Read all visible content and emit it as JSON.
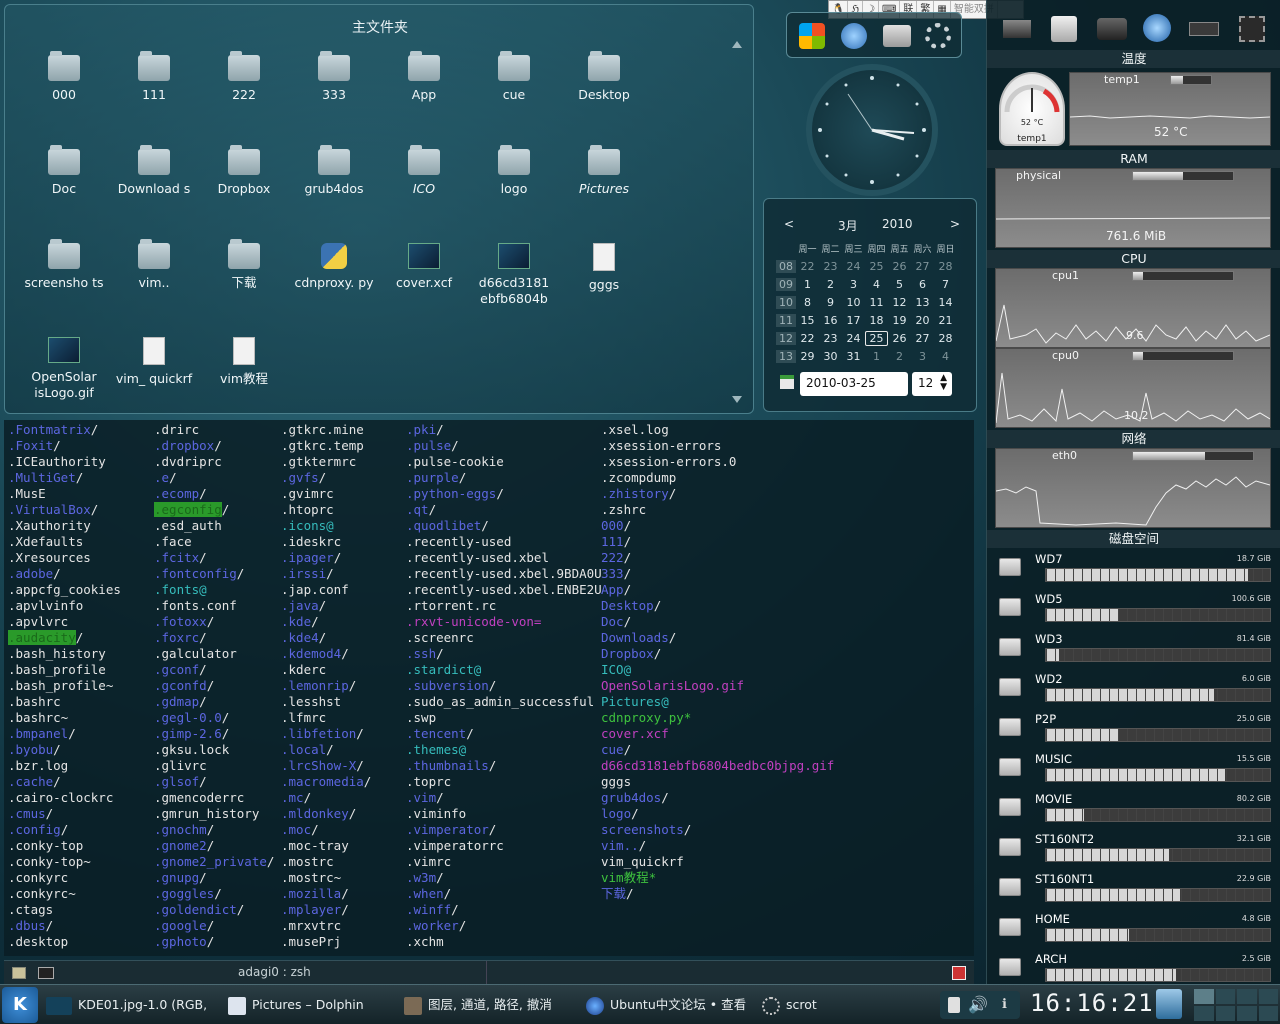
{
  "input_method": {
    "items": [
      "联",
      "繁",
      "智能双拼"
    ]
  },
  "folder_view": {
    "title": "主文件夹",
    "items": [
      {
        "label": "000",
        "kind": "folder"
      },
      {
        "label": "111",
        "kind": "folder"
      },
      {
        "label": "222",
        "kind": "folder"
      },
      {
        "label": "333",
        "kind": "folder"
      },
      {
        "label": "App",
        "kind": "folder"
      },
      {
        "label": "cue",
        "kind": "folder"
      },
      {
        "label": "Desktop",
        "kind": "folder"
      },
      {
        "label": "Doc",
        "kind": "folder"
      },
      {
        "label": "Download s",
        "kind": "folder"
      },
      {
        "label": "Dropbox",
        "kind": "folder"
      },
      {
        "label": "grub4dos",
        "kind": "folder"
      },
      {
        "label": "ICO",
        "kind": "folder-link"
      },
      {
        "label": "logo",
        "kind": "folder"
      },
      {
        "label": "Pictures",
        "kind": "folder-link"
      },
      {
        "label": "screensho ts",
        "kind": "folder"
      },
      {
        "label": "vim..",
        "kind": "folder"
      },
      {
        "label": "下载",
        "kind": "folder"
      },
      {
        "label": "cdnproxy. py",
        "kind": "python"
      },
      {
        "label": "cover.xcf",
        "kind": "image"
      },
      {
        "label": "d66cd3181 ebfb6804b",
        "kind": "image"
      },
      {
        "label": "gggs",
        "kind": "document"
      },
      {
        "label": "OpenSolar isLogo.gif",
        "kind": "image"
      },
      {
        "label": "vim_ quickrf",
        "kind": "document"
      },
      {
        "label": "vim教程",
        "kind": "document"
      }
    ]
  },
  "terminal": {
    "title": "adagi0 : zsh",
    "columns": [
      [
        [
          "c-dir",
          ".Fontmatrix"
        ],
        [
          "c-dir",
          ".Foxit"
        ],
        [
          "c-plain",
          ".ICEauthority"
        ],
        [
          "c-dir",
          ".MultiGet"
        ],
        [
          "c-plain",
          ".MusE"
        ],
        [
          "c-dir",
          ".VirtualBox"
        ],
        [
          "c-plain",
          ".Xauthority"
        ],
        [
          "c-plain",
          ".Xdefaults"
        ],
        [
          "c-plain",
          ".Xresources"
        ],
        [
          "c-dir",
          ".adobe"
        ],
        [
          "c-plain",
          ".appcfg_cookies"
        ],
        [
          "c-plain",
          ".apvlvinfo"
        ],
        [
          "c-plain",
          ".apvlvrc"
        ],
        [
          "c-hl",
          ".audacity"
        ],
        [
          "c-plain",
          ".bash_history"
        ],
        [
          "c-plain",
          ".bash_profile"
        ],
        [
          "c-plain",
          ".bash_profile~"
        ],
        [
          "c-plain",
          ".bashrc"
        ],
        [
          "c-plain",
          ".bashrc~"
        ],
        [
          "c-dir",
          ".bmpanel"
        ],
        [
          "c-dir",
          ".byobu"
        ],
        [
          "c-plain",
          ".bzr.log"
        ],
        [
          "c-dir",
          ".cache"
        ],
        [
          "c-plain",
          ".cairo-clockrc"
        ],
        [
          "c-dir",
          ".cmus"
        ],
        [
          "c-dir",
          ".config"
        ],
        [
          "c-plain",
          ".conky-top"
        ],
        [
          "c-plain",
          ".conky-top~"
        ],
        [
          "c-plain",
          ".conkyrc"
        ],
        [
          "c-plain",
          ".conkyrc~"
        ],
        [
          "c-plain",
          ".ctags"
        ],
        [
          "c-dir",
          ".dbus"
        ],
        [
          "c-plain",
          ".desktop"
        ]
      ],
      [
        [
          "c-plain",
          ".drirc"
        ],
        [
          "c-dir",
          ".dropbox"
        ],
        [
          "c-plain",
          ".dvdriprc"
        ],
        [
          "c-dir",
          ".e"
        ],
        [
          "c-dir",
          ".ecomp"
        ],
        [
          "c-hl",
          ".egconfig"
        ],
        [
          "c-plain",
          ".esd_auth"
        ],
        [
          "c-plain",
          ".face"
        ],
        [
          "c-dir",
          ".fcitx"
        ],
        [
          "c-dir",
          ".fontconfig"
        ],
        [
          "c-link",
          ".fonts@"
        ],
        [
          "c-plain",
          ".fonts.conf"
        ],
        [
          "c-dir",
          ".fotoxx"
        ],
        [
          "c-dir",
          ".foxrc"
        ],
        [
          "c-plain",
          ".galculator"
        ],
        [
          "c-dir",
          ".gconf"
        ],
        [
          "c-dir",
          ".gconfd"
        ],
        [
          "c-dir",
          ".gdmap"
        ],
        [
          "c-dir",
          ".gegl-0.0"
        ],
        [
          "c-dir",
          ".gimp-2.6"
        ],
        [
          "c-plain",
          ".gksu.lock"
        ],
        [
          "c-plain",
          ".glivrc"
        ],
        [
          "c-dir",
          ".glsof"
        ],
        [
          "c-plain",
          ".gmencoderrc"
        ],
        [
          "c-plain",
          ".gmrun_history"
        ],
        [
          "c-dir",
          ".gnochm"
        ],
        [
          "c-dir",
          ".gnome2"
        ],
        [
          "c-dir",
          ".gnome2_private"
        ],
        [
          "c-dir",
          ".gnupg"
        ],
        [
          "c-dir",
          ".goggles"
        ],
        [
          "c-dir",
          ".goldendict"
        ],
        [
          "c-dir",
          ".google"
        ],
        [
          "c-dir",
          ".gphoto"
        ]
      ],
      [
        [
          "c-plain",
          ".gtkrc.mine"
        ],
        [
          "c-plain",
          ".gtkrc.temp"
        ],
        [
          "c-plain",
          ".gtktermrc"
        ],
        [
          "c-dir",
          ".gvfs"
        ],
        [
          "c-plain",
          ".gvimrc"
        ],
        [
          "c-plain",
          ".htoprc"
        ],
        [
          "c-link",
          ".icons@"
        ],
        [
          "c-plain",
          ".ideskrc"
        ],
        [
          "c-dir",
          ".ipager"
        ],
        [
          "c-dir",
          ".irssi"
        ],
        [
          "c-plain",
          ".jap.conf"
        ],
        [
          "c-dir",
          ".java"
        ],
        [
          "c-dir",
          ".kde"
        ],
        [
          "c-dir",
          ".kde4"
        ],
        [
          "c-dir",
          ".kdemod4"
        ],
        [
          "c-plain",
          ".kderc"
        ],
        [
          "c-dir",
          ".lemonrip"
        ],
        [
          "c-plain",
          ".lesshst"
        ],
        [
          "c-plain",
          ".lfmrc"
        ],
        [
          "c-dir",
          ".libfetion"
        ],
        [
          "c-dir",
          ".local"
        ],
        [
          "c-dir",
          ".lrcShow-X"
        ],
        [
          "c-dir",
          ".macromedia"
        ],
        [
          "c-dir",
          ".mc"
        ],
        [
          "c-dir",
          ".mldonkey"
        ],
        [
          "c-dir",
          ".moc"
        ],
        [
          "c-plain",
          ".moc-tray"
        ],
        [
          "c-plain",
          ".mostrc"
        ],
        [
          "c-plain",
          ".mostrc~"
        ],
        [
          "c-dir",
          ".mozilla"
        ],
        [
          "c-dir",
          ".mplayer"
        ],
        [
          "c-plain",
          ".mrxvtrc"
        ],
        [
          "c-plain",
          ".musePrj"
        ]
      ],
      [
        [
          "c-dir",
          ".pki"
        ],
        [
          "c-dir",
          ".pulse"
        ],
        [
          "c-plain",
          ".pulse-cookie"
        ],
        [
          "c-dir",
          ".purple"
        ],
        [
          "c-dir",
          ".python-eggs"
        ],
        [
          "c-dir",
          ".qt"
        ],
        [
          "c-dir",
          ".quodlibet"
        ],
        [
          "c-plain",
          ".recently-used"
        ],
        [
          "c-plain",
          ".recently-used.xbel"
        ],
        [
          "c-plain",
          ".recently-used.xbel.9BDA0U"
        ],
        [
          "c-plain",
          ".recently-used.xbel.ENBE2U"
        ],
        [
          "c-plain",
          ".rtorrent.rc"
        ],
        [
          "c-img",
          ".rxvt-unicode-von="
        ],
        [
          "c-plain",
          ".screenrc"
        ],
        [
          "c-dir",
          ".ssh"
        ],
        [
          "c-link",
          ".stardict@"
        ],
        [
          "c-dir",
          ".subversion"
        ],
        [
          "c-plain",
          ".sudo_as_admin_successful"
        ],
        [
          "c-plain",
          ".swp"
        ],
        [
          "c-dir",
          ".tencent"
        ],
        [
          "c-link",
          ".themes@"
        ],
        [
          "c-dir",
          ".thumbnails"
        ],
        [
          "c-plain",
          ".toprc"
        ],
        [
          "c-dir",
          ".vim"
        ],
        [
          "c-plain",
          ".viminfo"
        ],
        [
          "c-dir",
          ".vimperator"
        ],
        [
          "c-plain",
          ".vimperatorrc"
        ],
        [
          "c-plain",
          ".vimrc"
        ],
        [
          "c-dir",
          ".w3m"
        ],
        [
          "c-dir",
          ".when"
        ],
        [
          "c-dir",
          ".winff"
        ],
        [
          "c-dir",
          ".worker"
        ],
        [
          "c-plain",
          ".xchm"
        ]
      ],
      [
        [
          "c-plain",
          ".xsel.log"
        ],
        [
          "c-plain",
          ".xsession-errors"
        ],
        [
          "c-plain",
          ".xsession-errors.0"
        ],
        [
          "c-plain",
          ".zcompdump"
        ],
        [
          "c-dir",
          ".zhistory"
        ],
        [
          "c-plain",
          ".zshrc"
        ],
        [
          "c-dir",
          "000"
        ],
        [
          "c-dir",
          "111"
        ],
        [
          "c-dir",
          "222"
        ],
        [
          "c-dir",
          "333"
        ],
        [
          "c-dir",
          "App"
        ],
        [
          "c-dir",
          "Desktop"
        ],
        [
          "c-dir",
          "Doc"
        ],
        [
          "c-dir",
          "Downloads"
        ],
        [
          "c-dir",
          "Dropbox"
        ],
        [
          "c-link",
          "ICO@"
        ],
        [
          "c-img",
          "OpenSolarisLogo.gif"
        ],
        [
          "c-link",
          "Pictures@"
        ],
        [
          "c-exe",
          "cdnproxy.py*"
        ],
        [
          "c-img",
          "cover.xcf"
        ],
        [
          "c-dir",
          "cue"
        ],
        [
          "c-img",
          "d66cd3181ebfb6804bedbc0bjpg.gif"
        ],
        [
          "c-plain",
          "gggs"
        ],
        [
          "c-dir",
          "grub4dos"
        ],
        [
          "c-dir",
          "logo"
        ],
        [
          "c-dir",
          "screenshots"
        ],
        [
          "c-dir",
          "vim.."
        ],
        [
          "c-plain",
          "vim_quickrf"
        ],
        [
          "c-exe",
          "vim教程*"
        ],
        [
          "c-dir",
          "下载"
        ]
      ]
    ]
  },
  "calendar": {
    "prev": "<",
    "next": ">",
    "month": "3月",
    "year": "2010",
    "day_headers": [
      "周一",
      "周二",
      "周三",
      "周四",
      "周五",
      "周六",
      "周日"
    ],
    "weeks": [
      {
        "wk": "08",
        "days": [
          "22",
          "23",
          "24",
          "25",
          "26",
          "27",
          "28"
        ],
        "dim": [
          1,
          1,
          1,
          1,
          1,
          1,
          1
        ]
      },
      {
        "wk": "09",
        "days": [
          "1",
          "2",
          "3",
          "4",
          "5",
          "6",
          "7"
        ],
        "dim": [
          0,
          0,
          0,
          0,
          0,
          0,
          0
        ]
      },
      {
        "wk": "10",
        "days": [
          "8",
          "9",
          "10",
          "11",
          "12",
          "13",
          "14"
        ],
        "dim": [
          0,
          0,
          0,
          0,
          0,
          0,
          0
        ]
      },
      {
        "wk": "11",
        "days": [
          "15",
          "16",
          "17",
          "18",
          "19",
          "20",
          "21"
        ],
        "dim": [
          0,
          0,
          0,
          0,
          0,
          0,
          0
        ]
      },
      {
        "wk": "12",
        "days": [
          "22",
          "23",
          "24",
          "25",
          "26",
          "27",
          "28"
        ],
        "dim": [
          0,
          0,
          0,
          0,
          0,
          0,
          0
        ]
      },
      {
        "wk": "13",
        "days": [
          "29",
          "30",
          "31",
          "1",
          "2",
          "3",
          "4"
        ],
        "dim": [
          0,
          0,
          0,
          1,
          1,
          1,
          1
        ]
      }
    ],
    "today": "25",
    "date_value": "2010-03-25",
    "week_value": "12"
  },
  "system_monitor": {
    "temperature": {
      "title": "温度",
      "gauge_value": "52 °C",
      "gauge_label": "temp1",
      "graph_label": "temp1",
      "graph_value": "52 °C",
      "bar_level": 0.3
    },
    "ram": {
      "title": "RAM",
      "label": "physical",
      "value": "761.6 MiB",
      "bar_level": 0.5
    },
    "cpu": {
      "title": "CPU",
      "cpu1_label": "cpu1",
      "cpu1_value": "9.6",
      "cpu0_label": "cpu0",
      "cpu0_value": "10.2",
      "cpu1_level": 0.1,
      "cpu0_level": 0.1
    },
    "network": {
      "title": "网络",
      "label": "eth0",
      "bar_level": 0.6
    },
    "disks_title": "磁盘空间",
    "disks": [
      {
        "name": "WD7",
        "size": "18.7 GiB",
        "used": 0.9
      },
      {
        "name": "WD5",
        "size": "100.6 GiB",
        "used": 0.32
      },
      {
        "name": "WD3",
        "size": "81.4 GiB",
        "used": 0.06
      },
      {
        "name": "WD2",
        "size": "6.0 GiB",
        "used": 0.75
      },
      {
        "name": "P2P",
        "size": "25.0 GiB",
        "used": 0.32
      },
      {
        "name": "MUSIC",
        "size": "15.5 GiB",
        "used": 0.8
      },
      {
        "name": "MOVIE",
        "size": "80.2 GiB",
        "used": 0.17
      },
      {
        "name": "ST160NT2",
        "size": "32.1 GiB",
        "used": 0.55
      },
      {
        "name": "ST160NT1",
        "size": "22.9 GiB",
        "used": 0.6
      },
      {
        "name": "HOME",
        "size": "4.8 GiB",
        "used": 0.37
      },
      {
        "name": "ARCH",
        "size": "2.5 GiB",
        "used": 0.58
      }
    ]
  },
  "taskbar": {
    "tasks": [
      {
        "label": "KDE01.jpg-1.0 (RGB,",
        "icon": "gimp-image-icon"
      },
      {
        "label": "Pictures – Dolphin",
        "icon": "dolphin-icon"
      },
      {
        "label": "图层, 通道, 路径, 撤消",
        "icon": "gimp-dock-icon"
      },
      {
        "label": "Ubuntu中文论坛 • 查看",
        "icon": "firefox-icon"
      },
      {
        "label": "scrot",
        "icon": "busy-icon"
      }
    ],
    "time": "16:16:21"
  }
}
